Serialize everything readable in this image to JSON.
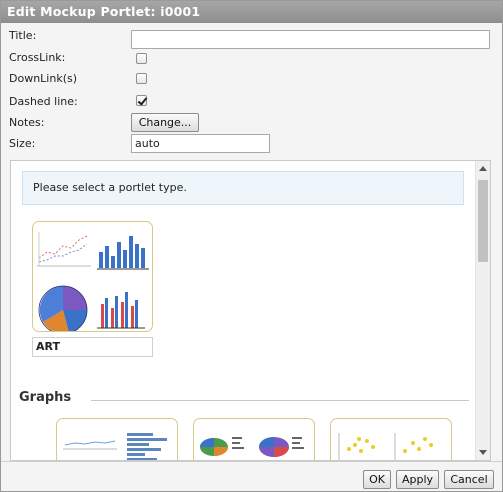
{
  "dialog": {
    "title": "Edit Mockup Portlet: i0001"
  },
  "form": {
    "title_label": "Title:",
    "title_value": "",
    "crosslink_label": "CrossLink:",
    "crosslink_checked": false,
    "downlinks_label": "DownLink(s)",
    "downlinks_checked": false,
    "dashed_label": "Dashed line:",
    "dashed_checked": true,
    "notes_label": "Notes:",
    "notes_button": "Change...",
    "size_label": "Size:",
    "size_value": "auto"
  },
  "panel": {
    "info_text": "Please select a portlet type.",
    "art_label": "ART",
    "section_graphs": "Graphs"
  },
  "footer": {
    "ok": "OK",
    "apply": "Apply",
    "cancel": "Cancel"
  },
  "colors": {
    "accent": "#d9c989",
    "titlebar": "#9b9b9b",
    "info_bg": "#eef6fb"
  },
  "icons": {
    "scroll_up": "chevron-up-icon",
    "scroll_down": "chevron-down-icon"
  }
}
